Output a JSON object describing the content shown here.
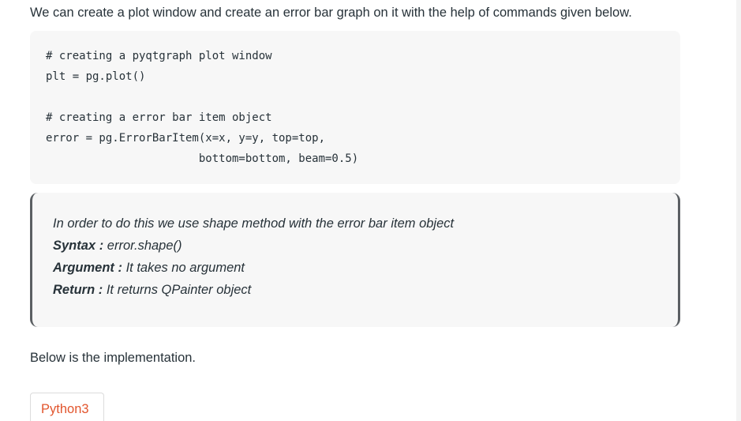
{
  "intro": {
    "text": "We can create a plot window and create an error bar graph on it with the help of commands given below."
  },
  "code": {
    "lines": [
      "# creating a pyqtgraph plot window",
      "plt = pg.plot()",
      "",
      "# creating a error bar item object",
      "error = pg.ErrorBarItem(x=x, y=y, top=top,",
      "                       bottom=bottom, beam=0.5)"
    ]
  },
  "note": {
    "description": "In order to do this we use shape method with the error bar item object",
    "syntax_label": "Syntax :",
    "syntax_value": " error.shape()",
    "argument_label": "Argument :",
    "argument_value": " It takes no argument",
    "return_label": "Return :",
    "return_value": " It returns QPainter object"
  },
  "implementation": {
    "text": "Below is the implementation."
  },
  "tabs": {
    "active": "Python3"
  }
}
